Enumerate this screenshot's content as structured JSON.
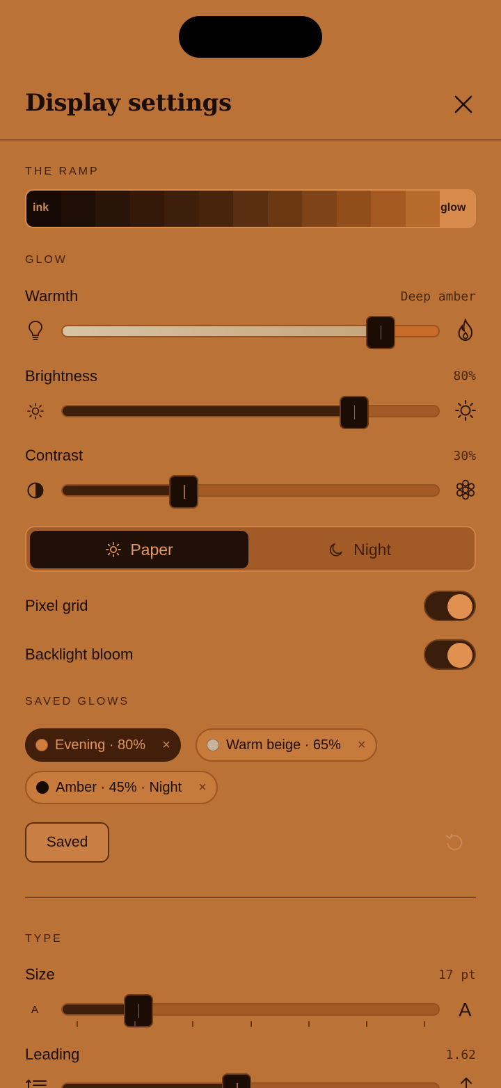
{
  "header": {
    "title": "Display settings"
  },
  "ramp": {
    "label": "THE RAMP",
    "start_label": "ink",
    "end_label": "glow",
    "swatches": [
      "#170a04",
      "#1e0e05",
      "#2a1407",
      "#341909",
      "#3e1f0b",
      "#48240d",
      "#5a2e10",
      "#6b3813",
      "#7e4317",
      "#914e1b",
      "#a45a22",
      "#b66a2c",
      "#d98b4d"
    ]
  },
  "glow": {
    "label": "GLOW",
    "warmth": {
      "label": "Warmth",
      "value": "Deep amber",
      "level": 0.84
    },
    "brightness": {
      "label": "Brightness",
      "value": "80%",
      "level": 0.77
    },
    "contrast": {
      "label": "Contrast",
      "value": "30%",
      "level": 0.32
    }
  },
  "mode": {
    "paper": "Paper",
    "night": "Night",
    "selected": "Paper"
  },
  "toggles": {
    "pixel_grid": {
      "label": "Pixel grid",
      "on": true
    },
    "backlight_bloom": {
      "label": "Backlight bloom",
      "on": true
    }
  },
  "saved_glows": {
    "label": "SAVED GLOWS",
    "chips": [
      {
        "label": "Evening · 80%",
        "dot": "#d07d3e",
        "active": true
      },
      {
        "label": "Warm beige · 65%",
        "dot": "#c7b49a",
        "active": false
      },
      {
        "label": "Amber · 45% · Night",
        "dot": "#140903",
        "active": false
      }
    ],
    "remove_glyph": "×",
    "saved_button": "Saved"
  },
  "type": {
    "label": "TYPE",
    "size": {
      "label": "Size",
      "value": "17 pt",
      "small_glyph": "A",
      "large_glyph": "A",
      "level": 0.2
    },
    "leading": {
      "label": "Leading",
      "value": "1.62",
      "level": 0.46
    }
  },
  "colors": {
    "background": "#bb7236",
    "dark": "#1c0d04",
    "accent": "#e0904f"
  }
}
